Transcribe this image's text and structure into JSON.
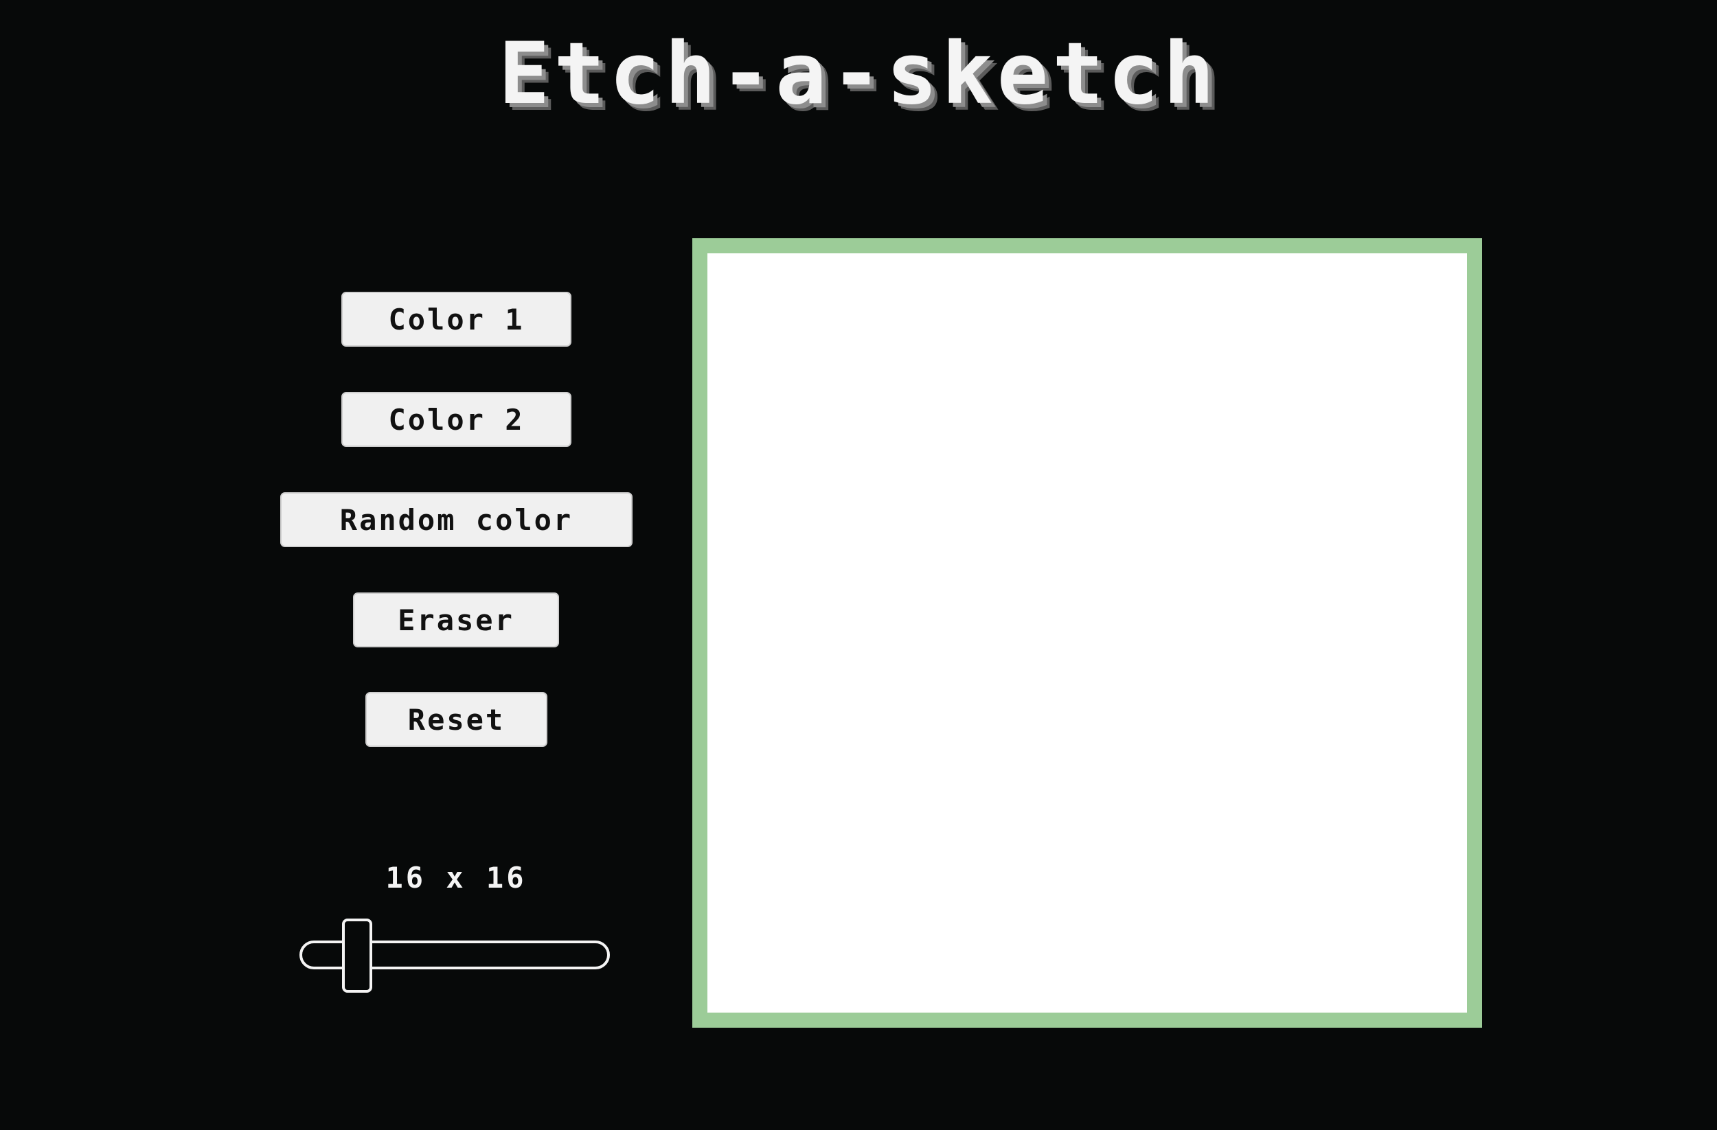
{
  "app": {
    "title": "Etch-a-sketch"
  },
  "controls": {
    "buttons": [
      {
        "id": "color-1",
        "label": "Color 1"
      },
      {
        "id": "color-2",
        "label": "Color 2"
      },
      {
        "id": "random-color",
        "label": "Random color"
      },
      {
        "id": "eraser",
        "label": "Eraser"
      },
      {
        "id": "reset",
        "label": "Reset"
      }
    ],
    "grid_size": {
      "label": "16 x 16",
      "value": 16,
      "min": 1,
      "max": 100
    }
  },
  "colors": {
    "background": "#070909",
    "board_border": "#9ccc98",
    "board_fill": "#ffffff",
    "button_fill": "#f0f0f0"
  }
}
